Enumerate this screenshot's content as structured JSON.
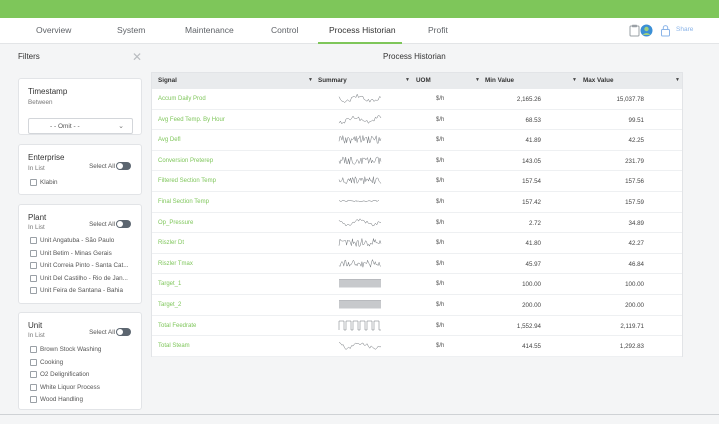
{
  "nav": {
    "tabs": [
      {
        "label": "Overview"
      },
      {
        "label": "System"
      },
      {
        "label": "Maintenance"
      },
      {
        "label": "Control"
      },
      {
        "label": "Process Historian"
      },
      {
        "label": "Profit"
      }
    ],
    "active_tab": "Process Historian",
    "share_label": "Share"
  },
  "filters": {
    "title": "Filters",
    "timestamp": {
      "title": "Timestamp",
      "sub": "Between",
      "selected": "- - Omit - -"
    },
    "enterprise": {
      "title": "Enterprise",
      "sub": "In List",
      "select_all": "Select All",
      "items": [
        "Klabin"
      ]
    },
    "plant": {
      "title": "Plant",
      "sub": "In List",
      "select_all": "Select All",
      "items": [
        "Unit Angatuba - São Paulo",
        "Unit Betim - Minas Gerais",
        "Unit Correia Pinto - Santa Cat...",
        "Unit Del Castilho - Rio de Jan...",
        "Unit Feira de Santana - Bahia"
      ]
    },
    "unit": {
      "title": "Unit",
      "sub": "In List",
      "select_all": "Select All",
      "items": [
        "Brown Stock Washing",
        "Cooking",
        "O2 Delignification",
        "White Liquor Process",
        "Wood Handling"
      ]
    }
  },
  "main": {
    "title": "Process Historian",
    "columns": [
      "Signal",
      "Summary",
      "UOM",
      "Min Value",
      "Max Value"
    ],
    "rows": [
      {
        "signal": "Accum Daily Prod",
        "uom": "$/h",
        "min": "2,165.26",
        "max": "15,037.78",
        "spark": "wave"
      },
      {
        "signal": "Avg Feed Temp. By Hour",
        "uom": "$/h",
        "min": "68.53",
        "max": "99.51",
        "spark": "wave"
      },
      {
        "signal": "Avg Defl",
        "uom": "$/h",
        "min": "41.89",
        "max": "42.25",
        "spark": "dense"
      },
      {
        "signal": "Conversion Preterep",
        "uom": "$/h",
        "min": "143.05",
        "max": "231.79",
        "spark": "dense"
      },
      {
        "signal": "Filtered Section Temp",
        "uom": "$/h",
        "min": "157.54",
        "max": "157.56",
        "spark": "noise"
      },
      {
        "signal": "Final Section Temp",
        "uom": "$/h",
        "min": "157.42",
        "max": "157.59",
        "spark": "flat"
      },
      {
        "signal": "Op_Pressure",
        "uom": "$/h",
        "min": "2.72",
        "max": "34.89",
        "spark": "wave"
      },
      {
        "signal": "Riszler Dt",
        "uom": "$/h",
        "min": "41.80",
        "max": "42.27",
        "spark": "dense"
      },
      {
        "signal": "Riszler Tmax",
        "uom": "$/h",
        "min": "45.97",
        "max": "46.84",
        "spark": "dense"
      },
      {
        "signal": "Target_1",
        "uom": "$/h",
        "min": "100.00",
        "max": "100.00",
        "spark": "bar"
      },
      {
        "signal": "Target_2",
        "uom": "$/h",
        "min": "200.00",
        "max": "200.00",
        "spark": "bar"
      },
      {
        "signal": "Total Feedrate",
        "uom": "$/h",
        "min": "1,552.94",
        "max": "2,119.71",
        "spark": "square"
      },
      {
        "signal": "Total Steam",
        "uom": "$/h",
        "min": "414.55",
        "max": "1,292.83",
        "spark": "wave"
      }
    ]
  },
  "colors": {
    "accent": "#7ec65a",
    "header_bg": "#e9ebed"
  }
}
